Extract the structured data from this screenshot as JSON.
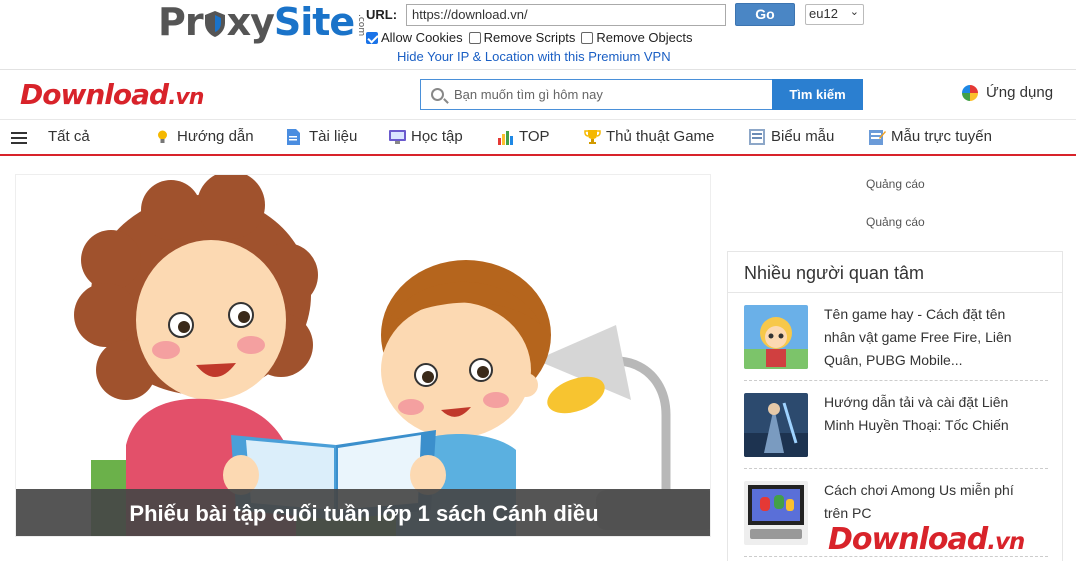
{
  "proxybar": {
    "logo_proxy": "Pr",
    "logo_proxy_rest": "xy",
    "logo_site": "Site",
    "logo_com": ".com",
    "url_label": "URL:",
    "url_value": "https://download.vn/",
    "go_label": "Go",
    "server": "eu12",
    "options": [
      {
        "label": "Allow Cookies",
        "checked": true
      },
      {
        "label": "Remove Scripts",
        "checked": false
      },
      {
        "label": "Remove Objects",
        "checked": false
      }
    ],
    "vpn_link": "Hide Your IP & Location with this Premium VPN"
  },
  "header": {
    "logo_main": "Download",
    "logo_suffix": ".vn",
    "search_placeholder": "Bạn muốn tìm gì hôm nay",
    "search_button": "Tìm kiếm",
    "apps_label": "Ứng dụng"
  },
  "nav": {
    "all_label": "Tất cả",
    "items": [
      {
        "label": "Hướng dẫn",
        "icon": "lightbulb-icon"
      },
      {
        "label": "Tài liệu",
        "icon": "document-icon"
      },
      {
        "label": "Học tập",
        "icon": "monitor-icon"
      },
      {
        "label": "TOP",
        "icon": "bar-chart-icon"
      },
      {
        "label": "Thủ thuật Game",
        "icon": "trophy-icon"
      },
      {
        "label": "Biểu mẫu",
        "icon": "form-icon"
      },
      {
        "label": "Mẫu trực tuyến",
        "icon": "edit-form-icon"
      }
    ]
  },
  "hero": {
    "caption": "Phiếu bài tập cuối tuần lớp 1 sách Cánh diều"
  },
  "sidebar": {
    "ad_label_1": "Quảng cáo",
    "ad_label_2": "Quảng cáo",
    "popular_title": "Nhiều người quan tâm",
    "items": [
      {
        "text": "Tên game hay - Cách đặt tên nhân vật game Free Fire, Liên Quân, PUBG Mobile..."
      },
      {
        "text": "Hướng dẫn tải và cài đặt Liên Minh Huyền Thoại: Tốc Chiến"
      },
      {
        "text": "Cách chơi Among Us miễn phí trên PC"
      }
    ],
    "watermark_main": "Download",
    "watermark_suffix": ".vn"
  },
  "colors": {
    "brand_red": "#d8232a",
    "accent_blue": "#2b7fd0",
    "proxy_blue": "#1a73c9"
  }
}
